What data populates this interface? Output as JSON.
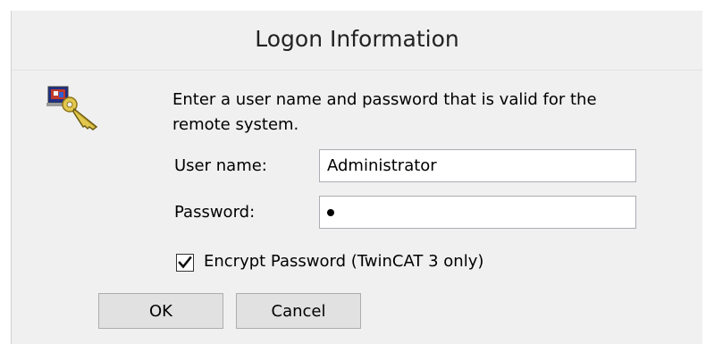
{
  "dialog": {
    "title": "Logon Information",
    "prompt": "Enter a user name and password that is valid for the remote system.",
    "icon": "logon-key-icon"
  },
  "form": {
    "username_label": "User name:",
    "username_value": "Administrator",
    "password_label": "Password:",
    "password_masked_length": 1,
    "encrypt_label": "Encrypt Password (TwinCAT 3 only)",
    "encrypt_checked": true
  },
  "buttons": {
    "ok_label": "OK",
    "cancel_label": "Cancel"
  },
  "colors": {
    "dialog_background": "#f0f0f0",
    "button_face": "#e1e1e1",
    "button_border": "#adadad",
    "field_border": "#abadb3"
  }
}
